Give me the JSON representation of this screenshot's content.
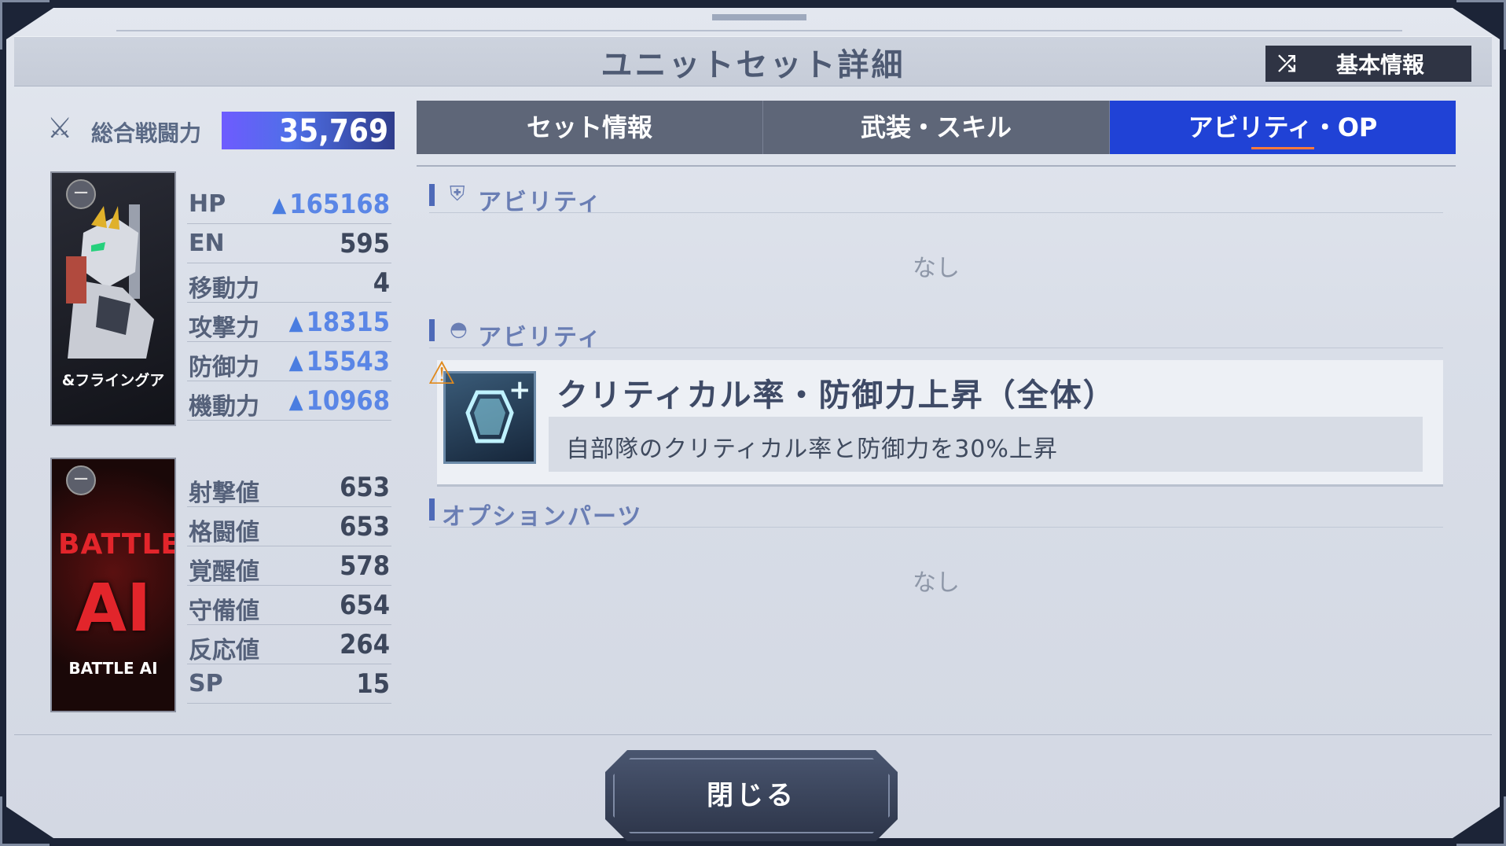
{
  "header": {
    "title": "ユニットセット詳細",
    "basic_info_label": "基本情報"
  },
  "power": {
    "label": "総合戦闘力",
    "value": "35,769"
  },
  "unit_card": {
    "caption": "&フライングア"
  },
  "ai_card": {
    "big_text": "AI",
    "top_text": "BATTLE",
    "caption": "BATTLE AI"
  },
  "unit_stats": [
    {
      "label": "HP",
      "value": "165168",
      "boosted": true
    },
    {
      "label": "EN",
      "value": "595",
      "boosted": false
    },
    {
      "label": "移動力",
      "value": "4",
      "boosted": false
    },
    {
      "label": "攻撃力",
      "value": "18315",
      "boosted": true
    },
    {
      "label": "防御力",
      "value": "15543",
      "boosted": true
    },
    {
      "label": "機動力",
      "value": "10968",
      "boosted": true
    }
  ],
  "pilot_stats": [
    {
      "label": "射撃値",
      "value": "653"
    },
    {
      "label": "格闘値",
      "value": "653"
    },
    {
      "label": "覚醒値",
      "value": "578"
    },
    {
      "label": "守備値",
      "value": "654"
    },
    {
      "label": "反応値",
      "value": "264"
    },
    {
      "label": "SP",
      "value": "15"
    }
  ],
  "tabs": [
    {
      "label": "セット情報",
      "active": false
    },
    {
      "label": "武装・スキル",
      "active": false
    },
    {
      "label": "アビリティ・OP",
      "active": true
    }
  ],
  "sections": {
    "unit_ability": {
      "title": "アビリティ",
      "icon": "mecha-head-icon",
      "empty_text": "なし"
    },
    "pilot_ability": {
      "title": "アビリティ",
      "icon": "pilot-helmet-icon",
      "item": {
        "name": "クリティカル率・防御力上昇（全体）",
        "description": "自部隊のクリティカル率と防御力を30%上昇"
      }
    },
    "options": {
      "title": "オプションパーツ",
      "empty_text": "なし"
    }
  },
  "footer": {
    "close_label": "閉じる"
  },
  "colors": {
    "accent": "#2042d6",
    "power_bar": "#5b5cf0",
    "boost": "#5a86e6"
  }
}
